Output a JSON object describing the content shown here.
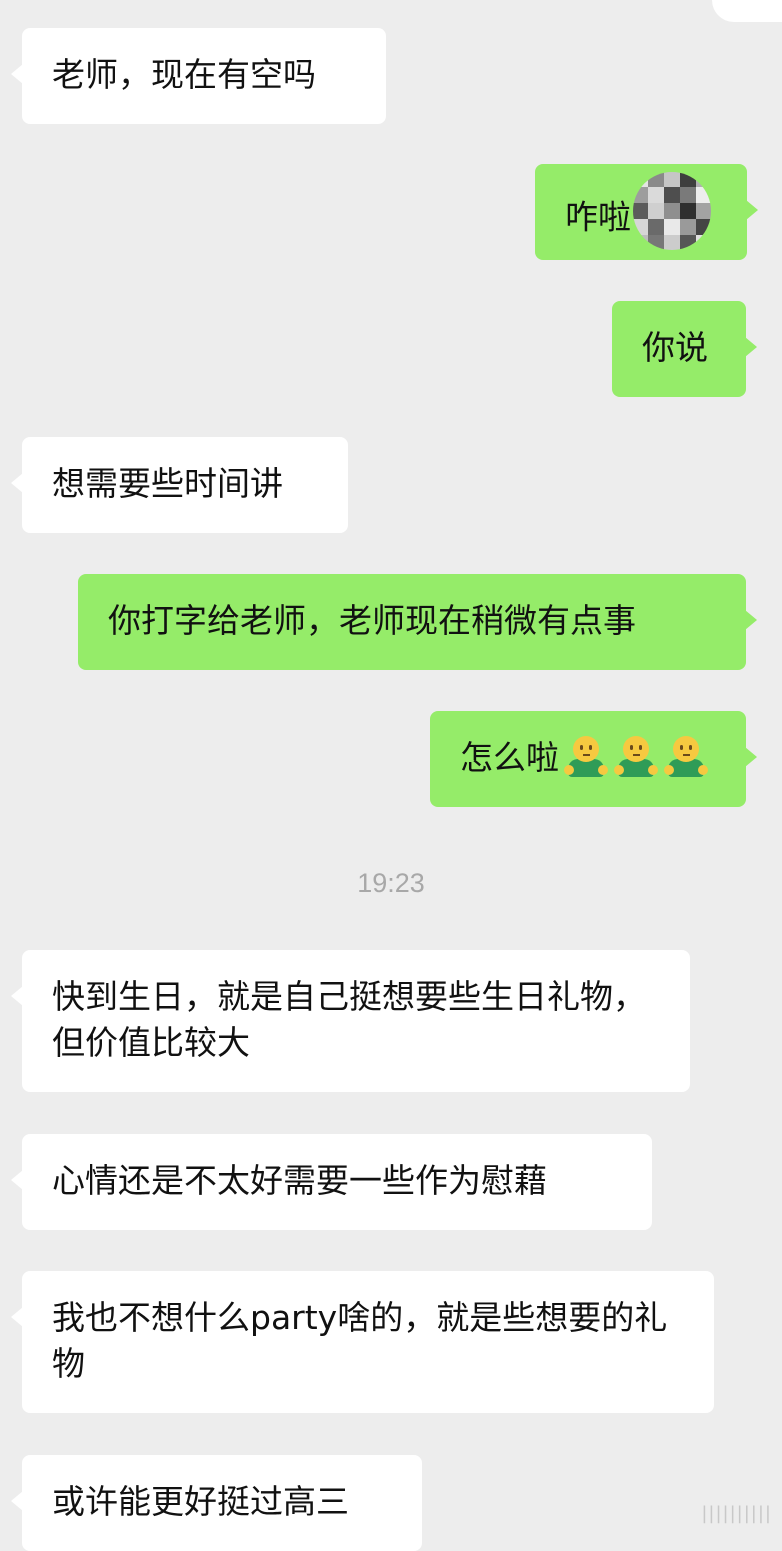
{
  "theme": {
    "background": "#ededed",
    "incoming_bubble": "#ffffff",
    "outgoing_bubble": "#95ec69",
    "text": "#111111",
    "timestamp_color": "#a8a8a8"
  },
  "messages": [
    {
      "type": "incoming",
      "text": "老师，现在有空吗"
    },
    {
      "type": "outgoing",
      "text": "咋啦",
      "attachment": "pixelated-emoji"
    },
    {
      "type": "outgoing",
      "text": "你说"
    },
    {
      "type": "incoming",
      "text": "想需要些时间讲"
    },
    {
      "type": "outgoing",
      "text": "你打字给老师，老师现在稍微有点事"
    },
    {
      "type": "outgoing",
      "text": "怎么啦",
      "emoji": [
        "shrug-emoji",
        "shrug-emoji",
        "shrug-emoji"
      ]
    },
    {
      "type": "timestamp",
      "text": "19:23"
    },
    {
      "type": "incoming",
      "text": "快到生日，就是自己挺想要些生日礼物，但价值比较大"
    },
    {
      "type": "incoming",
      "text": "心情还是不太好需要一些作为慰藉"
    },
    {
      "type": "incoming",
      "text": "我也不想什么party啥的，就是些想要的礼物"
    },
    {
      "type": "incoming",
      "text": "或许能更好挺过高三"
    }
  ]
}
